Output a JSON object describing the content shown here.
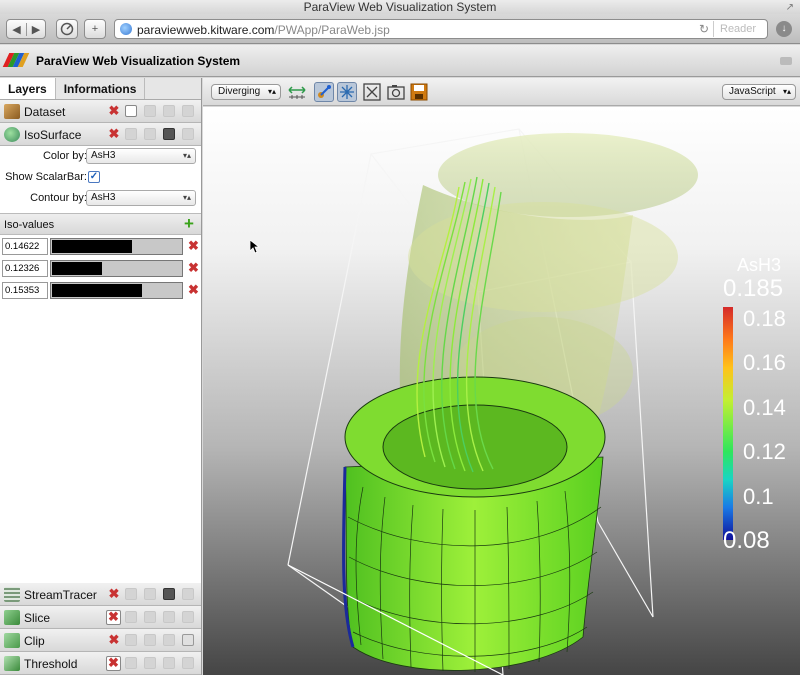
{
  "browser": {
    "window_title": "ParaView Web Visualization System",
    "url_host": "paraviewweb.kitware.com",
    "url_path": "/PWApp/ParaWeb.jsp",
    "reader_label": "Reader",
    "reload_glyph": "↻",
    "resize_glyph": "↗",
    "back_glyph": "◀",
    "forward_glyph": "▶",
    "new_tab_glyph": "+",
    "download_glyph": "↓"
  },
  "app": {
    "title": "ParaView Web Visualization System",
    "logo_colors": [
      "#e02020",
      "#2a9a2a",
      "#2060d0",
      "#e0a020"
    ]
  },
  "left_panel": {
    "tabs": [
      {
        "label": "Layers",
        "active": true
      },
      {
        "label": "Informations",
        "active": false
      }
    ],
    "layers_top": [
      {
        "name": "Dataset",
        "icon": "cube-icon"
      },
      {
        "name": "IsoSurface",
        "icon": "isosurface-icon"
      }
    ],
    "properties": {
      "color_by_label": "Color by:",
      "color_by_value": "AsH3",
      "show_scalarbar_label": "Show ScalarBar:",
      "show_scalarbar_checked": true,
      "check_glyph": "✓",
      "contour_by_label": "Contour by:",
      "contour_by_value": "AsH3"
    },
    "iso_values": {
      "label": "Iso-values",
      "add_glyph": "+",
      "delete_glyph": "✖",
      "rows": [
        {
          "value": "0.14622",
          "fraction": 0.61
        },
        {
          "value": "0.12326",
          "fraction": 0.38
        },
        {
          "value": "0.15353",
          "fraction": 0.69
        }
      ]
    },
    "layers_bottom": [
      {
        "name": "StreamTracer",
        "icon": "streamtracer-icon"
      },
      {
        "name": "Slice",
        "icon": "slice-icon"
      },
      {
        "name": "Clip",
        "icon": "clip-icon"
      },
      {
        "name": "Threshold",
        "icon": "threshold-icon"
      }
    ]
  },
  "view_toolbar": {
    "colormap": "Diverging",
    "renderer": "JavaScript",
    "caret_glyph": "▾▴"
  },
  "scalar_bar": {
    "title": "AsH3",
    "ticks": [
      "0.185",
      "0.18",
      "0.16",
      "0.14",
      "0.12",
      "0.1",
      "0.08"
    ],
    "range": [
      0.08,
      0.185
    ]
  }
}
